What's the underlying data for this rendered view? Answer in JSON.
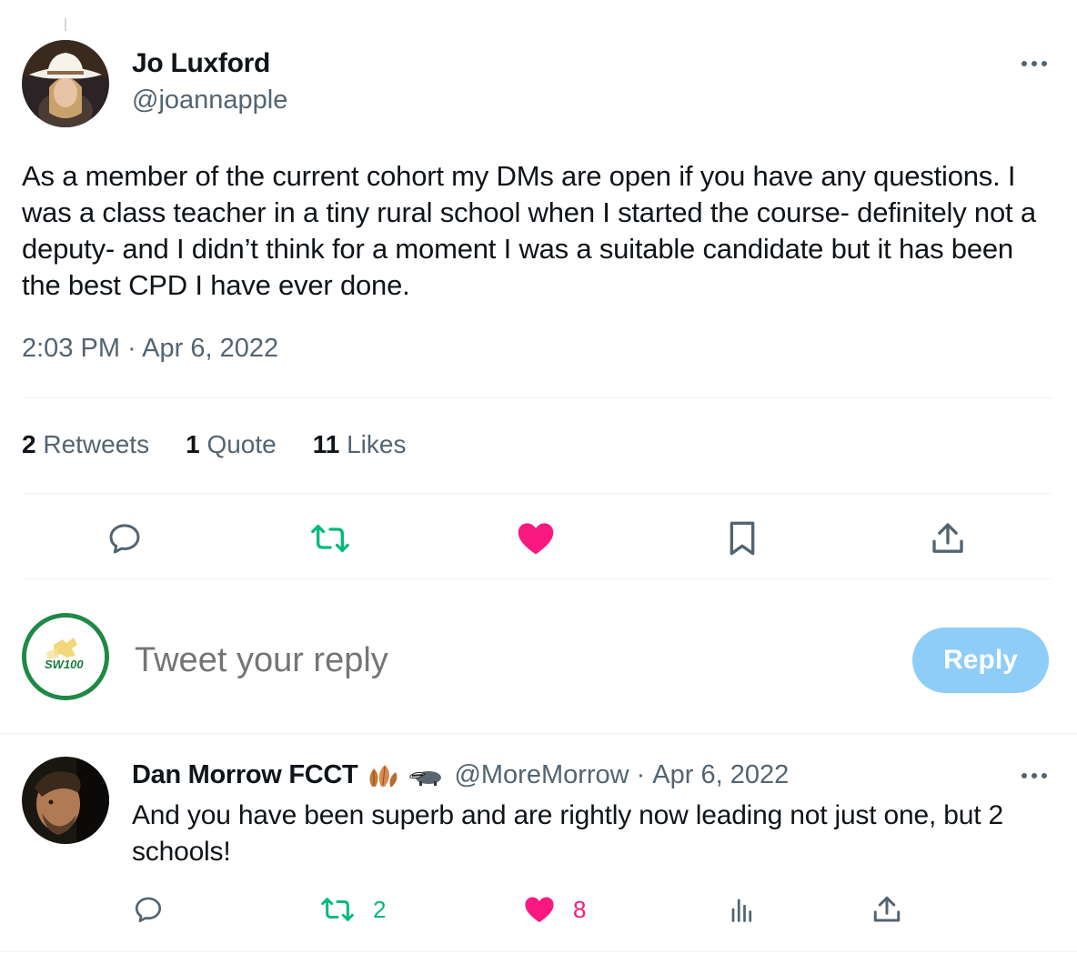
{
  "main_tweet": {
    "author_name": "Jo Luxford",
    "author_handle": "@joannapple",
    "text": "As a member of the current cohort my DMs are open if you have any questions. I was a class teacher in a tiny rural school when I started the course- definitely not a deputy- and I didn’t think for a moment I was a suitable candidate but it has been the best CPD I have ever done.",
    "timestamp": "2:03 PM · Apr 6, 2022",
    "stats": {
      "retweets_count": "2",
      "retweets_label": "Retweets",
      "quotes_count": "1",
      "quotes_label": "Quote",
      "likes_count": "11",
      "likes_label": "Likes"
    },
    "actions": [
      "reply-icon",
      "retweet-icon",
      "like-icon",
      "bookmark-icon",
      "share-icon"
    ]
  },
  "composer": {
    "avatar_label": "SW100",
    "placeholder": "Tweet your reply",
    "reply_button": "Reply"
  },
  "reply_tweet": {
    "author_name": "Dan Morrow FCCT",
    "author_handle": "@MoreMorrow",
    "separator": "·",
    "date": "Apr 6, 2022",
    "text": "And you have been superb and are rightly now leading not just one, but 2 schools!",
    "retweet_count": "2",
    "like_count": "8"
  },
  "colors": {
    "text_primary": "#0f1419",
    "text_secondary": "#536471",
    "retweet_green": "#00ba7c",
    "like_pink": "#f91880",
    "reply_button_bg": "#8ecdf7",
    "composer_ring": "#1e8a45"
  }
}
